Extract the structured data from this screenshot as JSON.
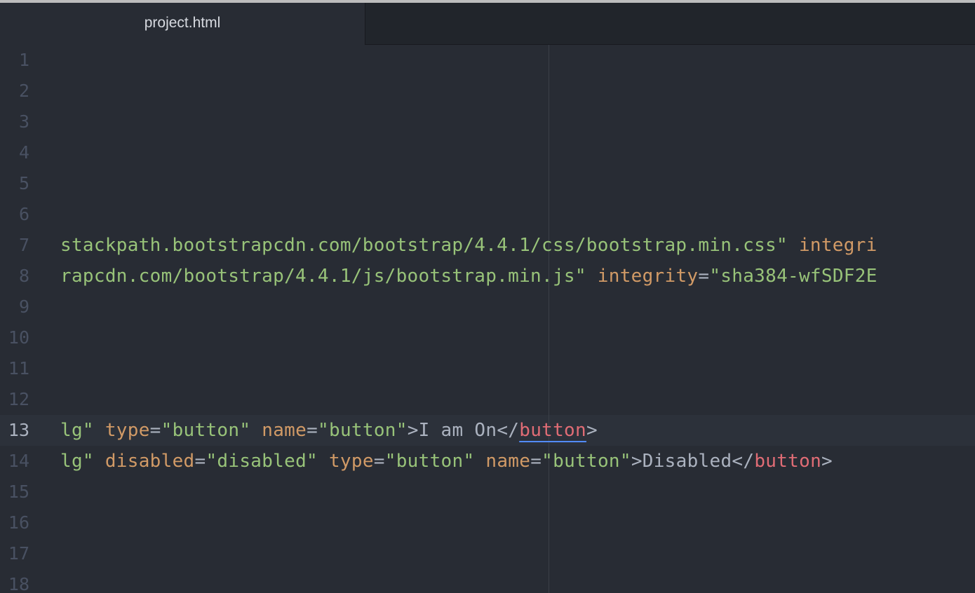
{
  "tabs": [
    {
      "label": "project.html",
      "active": true
    }
  ],
  "line_numbers": [
    "1",
    "2",
    "3",
    "4",
    "5",
    "6",
    "7",
    "8",
    "9",
    "10",
    "11",
    "12",
    "13",
    "14",
    "15",
    "16",
    "17",
    "18"
  ],
  "current_line": "13",
  "code": {
    "line7": {
      "s1": "stackpath.bootstrapcdn.com/bootstrap/4.4.1/css/bootstrap.min.css\"",
      "sp": " ",
      "a1": "integri"
    },
    "line8": {
      "s1": "rapcdn.com/bootstrap/4.4.1/js/bootstrap.min.js\"",
      "sp": " ",
      "a1": "integrity",
      "eq": "=",
      "s2": "\"sha384-wfSDF2E"
    },
    "line13": {
      "s1": "lg\"",
      "sp1": " ",
      "a1": "type",
      "eq1": "=",
      "s2": "\"button\"",
      "sp2": " ",
      "a2": "name",
      "eq2": "=",
      "s3": "\"button\"",
      "t1": ">I am On</",
      "tag": "button",
      "t2": ">"
    },
    "line14": {
      "s1": "lg\"",
      "sp1": " ",
      "a1": "disabled",
      "eq1": "=",
      "s2": "\"disabled\"",
      "sp2": " ",
      "a2": "type",
      "eq2": "=",
      "s3": "\"button\"",
      "sp3": " ",
      "a3": "name",
      "eq3": "=",
      "s4": "\"button\"",
      "t1": ">Disabled</",
      "tag": "button",
      "t2": ">"
    }
  },
  "colors": {
    "background": "#282c34",
    "string": "#98c379",
    "attribute": "#d19a66",
    "tag": "#e06c75",
    "text": "#abb2bf",
    "bracket_match_underline": "#528bff"
  }
}
